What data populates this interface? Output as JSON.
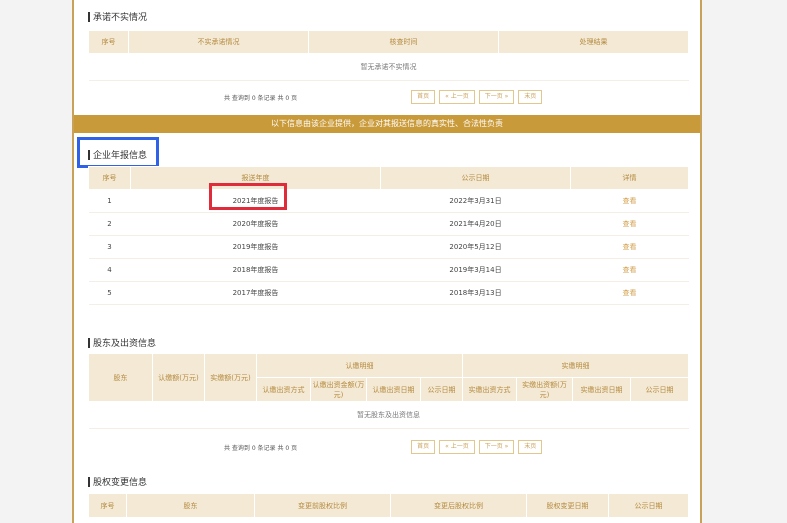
{
  "pledge": {
    "title": "承诺不实情况",
    "headers": [
      "序号",
      "不实承诺情况",
      "核查时间",
      "处理结果"
    ],
    "empty": "暂无承诺不实情况"
  },
  "pager": {
    "summary": "共 查询到 0 条记录 共 0 页",
    "first": "首页",
    "prev": "« 上一页",
    "next": "下一页 »",
    "last": "末页"
  },
  "banner": "以下信息由该企业提供，企业对其报送信息的真实性、合法性负责",
  "annual": {
    "title": "企业年报信息",
    "headers": [
      "序号",
      "报送年度",
      "公示日期",
      "详情"
    ],
    "rows": [
      {
        "no": "1",
        "year": "2021年度报告",
        "date": "2022年3月31日",
        "detail": "查看"
      },
      {
        "no": "2",
        "year": "2020年度报告",
        "date": "2021年4月20日",
        "detail": "查看"
      },
      {
        "no": "3",
        "year": "2019年度报告",
        "date": "2020年5月12日",
        "detail": "查看"
      },
      {
        "no": "4",
        "year": "2018年度报告",
        "date": "2019年3月14日",
        "detail": "查看"
      },
      {
        "no": "5",
        "year": "2017年度报告",
        "date": "2018年3月13日",
        "detail": "查看"
      }
    ]
  },
  "shareholders": {
    "title": "股东及出资信息",
    "h_holder": "股东",
    "h_sub_amount": "认缴额(万元)",
    "h_paid_amount": "实缴额(万元)",
    "h_sub_detail": "认缴明细",
    "h_paid_detail": "实缴明细",
    "sub_cols": [
      "认缴出资方式",
      "认缴出资金额(万元)",
      "认缴出资日期",
      "公示日期"
    ],
    "paid_cols": [
      "实缴出资方式",
      "实缴出资额(万元)",
      "实缴出资日期",
      "公示日期"
    ],
    "empty": "暂无股东及出资信息"
  },
  "equity": {
    "title": "股权变更信息",
    "headers": [
      "序号",
      "股东",
      "变更前股权比例",
      "变更后股权比例",
      "股权变更日期",
      "公示日期"
    ]
  }
}
